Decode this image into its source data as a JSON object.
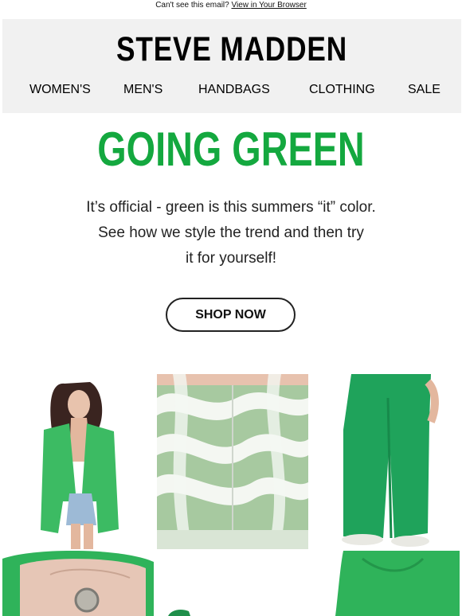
{
  "preheader": {
    "text": "Can't see this email?",
    "link_label": "View in Your Browser"
  },
  "header": {
    "logo": "STEVE MADDEN",
    "nav": [
      {
        "label": "WOMEN'S"
      },
      {
        "label": "MEN'S"
      },
      {
        "label": "HANDBAGS"
      },
      {
        "label": "CLOTHING"
      },
      {
        "label": "SALE"
      }
    ]
  },
  "hero": {
    "headline": "GOING GREEN",
    "body_lines": [
      "It’s official - green is this summers “it” color.",
      "See how we style the trend and then try",
      "it for yourself!"
    ],
    "cta_label": "SHOP NOW"
  },
  "colors": {
    "accent_green": "#14a83f",
    "header_bg": "#f1f1f1",
    "product_green": "#2fb35a"
  },
  "products": [
    {
      "icon": "green-blazer-photo"
    },
    {
      "icon": "swirl-corset-photo"
    },
    {
      "icon": "green-pants-photo"
    },
    {
      "icon": "green-bag-photo"
    },
    {
      "icon": "green-shoe-photo"
    },
    {
      "icon": "green-top-photo"
    }
  ]
}
